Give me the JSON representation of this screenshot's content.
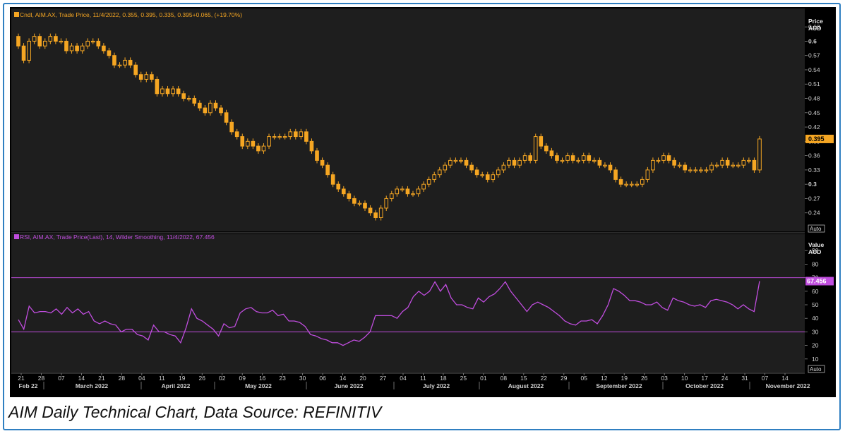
{
  "caption": "AIM Daily Technical Chart, Data Source: REFINITIV",
  "upper_legend": "Cndl, AIM.AX, Trade Price, 11/4/2022, 0.355, 0.395, 0.335, 0.395+0.065, (+19.70%)",
  "lower_legend": "RSI, AIM.AX, Trade Price(Last), 14, Wilder Smoothing, 11/4/2022, 67.456",
  "price_axis_title": [
    "Price",
    "AUD"
  ],
  "rsi_axis_title": [
    "Value",
    "AUD"
  ],
  "auto_label": "Auto",
  "last_price_label": "0.395",
  "last_rsi_label": "67.456",
  "colors": {
    "panel": "#1e1e1e",
    "candle": "#f5a623",
    "rsi": "#c04dde",
    "axis_text": "#cfcfcf",
    "bg": "#000000",
    "frame": "#2f7fc1"
  },
  "chart_data": [
    {
      "type": "candlestick",
      "title": "Cndl, AIM.AX, Trade Price, 11/4/2022, 0.355, 0.395, 0.335, 0.395+0.065, (+19.70%)",
      "ylabel": "Price AUD",
      "ylim": [
        0.21,
        0.645
      ],
      "y_ticks": [
        "0.63",
        "0.6",
        "0.57",
        "0.54",
        "0.51",
        "0.48",
        "0.45",
        "0.42",
        "0.39",
        "0.36",
        "0.33",
        "0.3",
        "0.27",
        "0.24"
      ],
      "x_day_ticks": [
        "21",
        "28",
        "07",
        "14",
        "21",
        "28",
        "04",
        "11",
        "19",
        "26",
        "02",
        "09",
        "16",
        "23",
        "30",
        "06",
        "14",
        "20",
        "27",
        "04",
        "11",
        "18",
        "25",
        "01",
        "08",
        "15",
        "22",
        "29",
        "05",
        "12",
        "19",
        "26",
        "03",
        "10",
        "17",
        "24",
        "31",
        "07",
        "14"
      ],
      "x_month_labels": [
        "Feb 22",
        "March 2022",
        "April 2022",
        "May 2022",
        "June 2022",
        "July 2022",
        "August 2022",
        "September 2022",
        "October 2022",
        "November 2022"
      ],
      "date_range": [
        "2022-02-21",
        "2022-11-04"
      ],
      "last_close": 0.395,
      "close": [
        0.59,
        0.56,
        0.6,
        0.61,
        0.59,
        0.6,
        0.61,
        0.6,
        0.6,
        0.58,
        0.59,
        0.58,
        0.59,
        0.6,
        0.6,
        0.59,
        0.58,
        0.57,
        0.55,
        0.55,
        0.56,
        0.55,
        0.53,
        0.52,
        0.53,
        0.52,
        0.49,
        0.5,
        0.49,
        0.5,
        0.49,
        0.48,
        0.48,
        0.47,
        0.46,
        0.45,
        0.47,
        0.46,
        0.45,
        0.43,
        0.41,
        0.4,
        0.38,
        0.39,
        0.38,
        0.37,
        0.38,
        0.4,
        0.4,
        0.4,
        0.4,
        0.41,
        0.4,
        0.41,
        0.39,
        0.37,
        0.35,
        0.34,
        0.32,
        0.3,
        0.29,
        0.28,
        0.27,
        0.26,
        0.26,
        0.25,
        0.24,
        0.23,
        0.25,
        0.27,
        0.28,
        0.29,
        0.29,
        0.28,
        0.28,
        0.29,
        0.3,
        0.31,
        0.32,
        0.33,
        0.34,
        0.35,
        0.35,
        0.35,
        0.34,
        0.33,
        0.32,
        0.32,
        0.31,
        0.32,
        0.33,
        0.34,
        0.35,
        0.34,
        0.35,
        0.36,
        0.35,
        0.4,
        0.38,
        0.37,
        0.36,
        0.35,
        0.35,
        0.36,
        0.35,
        0.35,
        0.36,
        0.35,
        0.35,
        0.34,
        0.34,
        0.33,
        0.31,
        0.3,
        0.3,
        0.3,
        0.3,
        0.31,
        0.33,
        0.35,
        0.35,
        0.36,
        0.35,
        0.34,
        0.34,
        0.33,
        0.33,
        0.33,
        0.33,
        0.33,
        0.34,
        0.34,
        0.35,
        0.34,
        0.34,
        0.34,
        0.35,
        0.35,
        0.33,
        0.395
      ]
    },
    {
      "type": "line",
      "title": "RSI, AIM.AX, Trade Price(Last), 14, Wilder Smoothing, 11/4/2022, 67.456",
      "ylabel": "Value AUD",
      "ylim": [
        0,
        100
      ],
      "y_ticks": [
        90,
        80,
        70,
        60,
        50,
        40,
        30,
        20,
        10
      ],
      "reference_lines": [
        70,
        30
      ],
      "last_value": 67.456,
      "series": [
        {
          "values": [
            39,
            32,
            49,
            44,
            45,
            45,
            44,
            47,
            43,
            48,
            44,
            47,
            43,
            45,
            38,
            36,
            38,
            36,
            35,
            30,
            32,
            32,
            28,
            27,
            24,
            35,
            30,
            30,
            28,
            27,
            22,
            33,
            47,
            40,
            38,
            35,
            32,
            27,
            36,
            33,
            34,
            44,
            47,
            48,
            45,
            44,
            44,
            46,
            42,
            43,
            38,
            38,
            37,
            34,
            28,
            27,
            25,
            24,
            22,
            22,
            20,
            22,
            24,
            23,
            26,
            30,
            42,
            42,
            42,
            42,
            40,
            45,
            48,
            56,
            60,
            57,
            60,
            67,
            60,
            65,
            55,
            50,
            50,
            48,
            47,
            55,
            52,
            56,
            58,
            62,
            67,
            60,
            55,
            50,
            45,
            50,
            52,
            50,
            48,
            45,
            42,
            38,
            36,
            35,
            38,
            38,
            39,
            36,
            42,
            50,
            62,
            60,
            57,
            53,
            53,
            52,
            50,
            50,
            52,
            48,
            46,
            55,
            53,
            52,
            50,
            49,
            50,
            48,
            53,
            54,
            53,
            52,
            50,
            47,
            50,
            47,
            45,
            67.456
          ]
        }
      ]
    }
  ]
}
